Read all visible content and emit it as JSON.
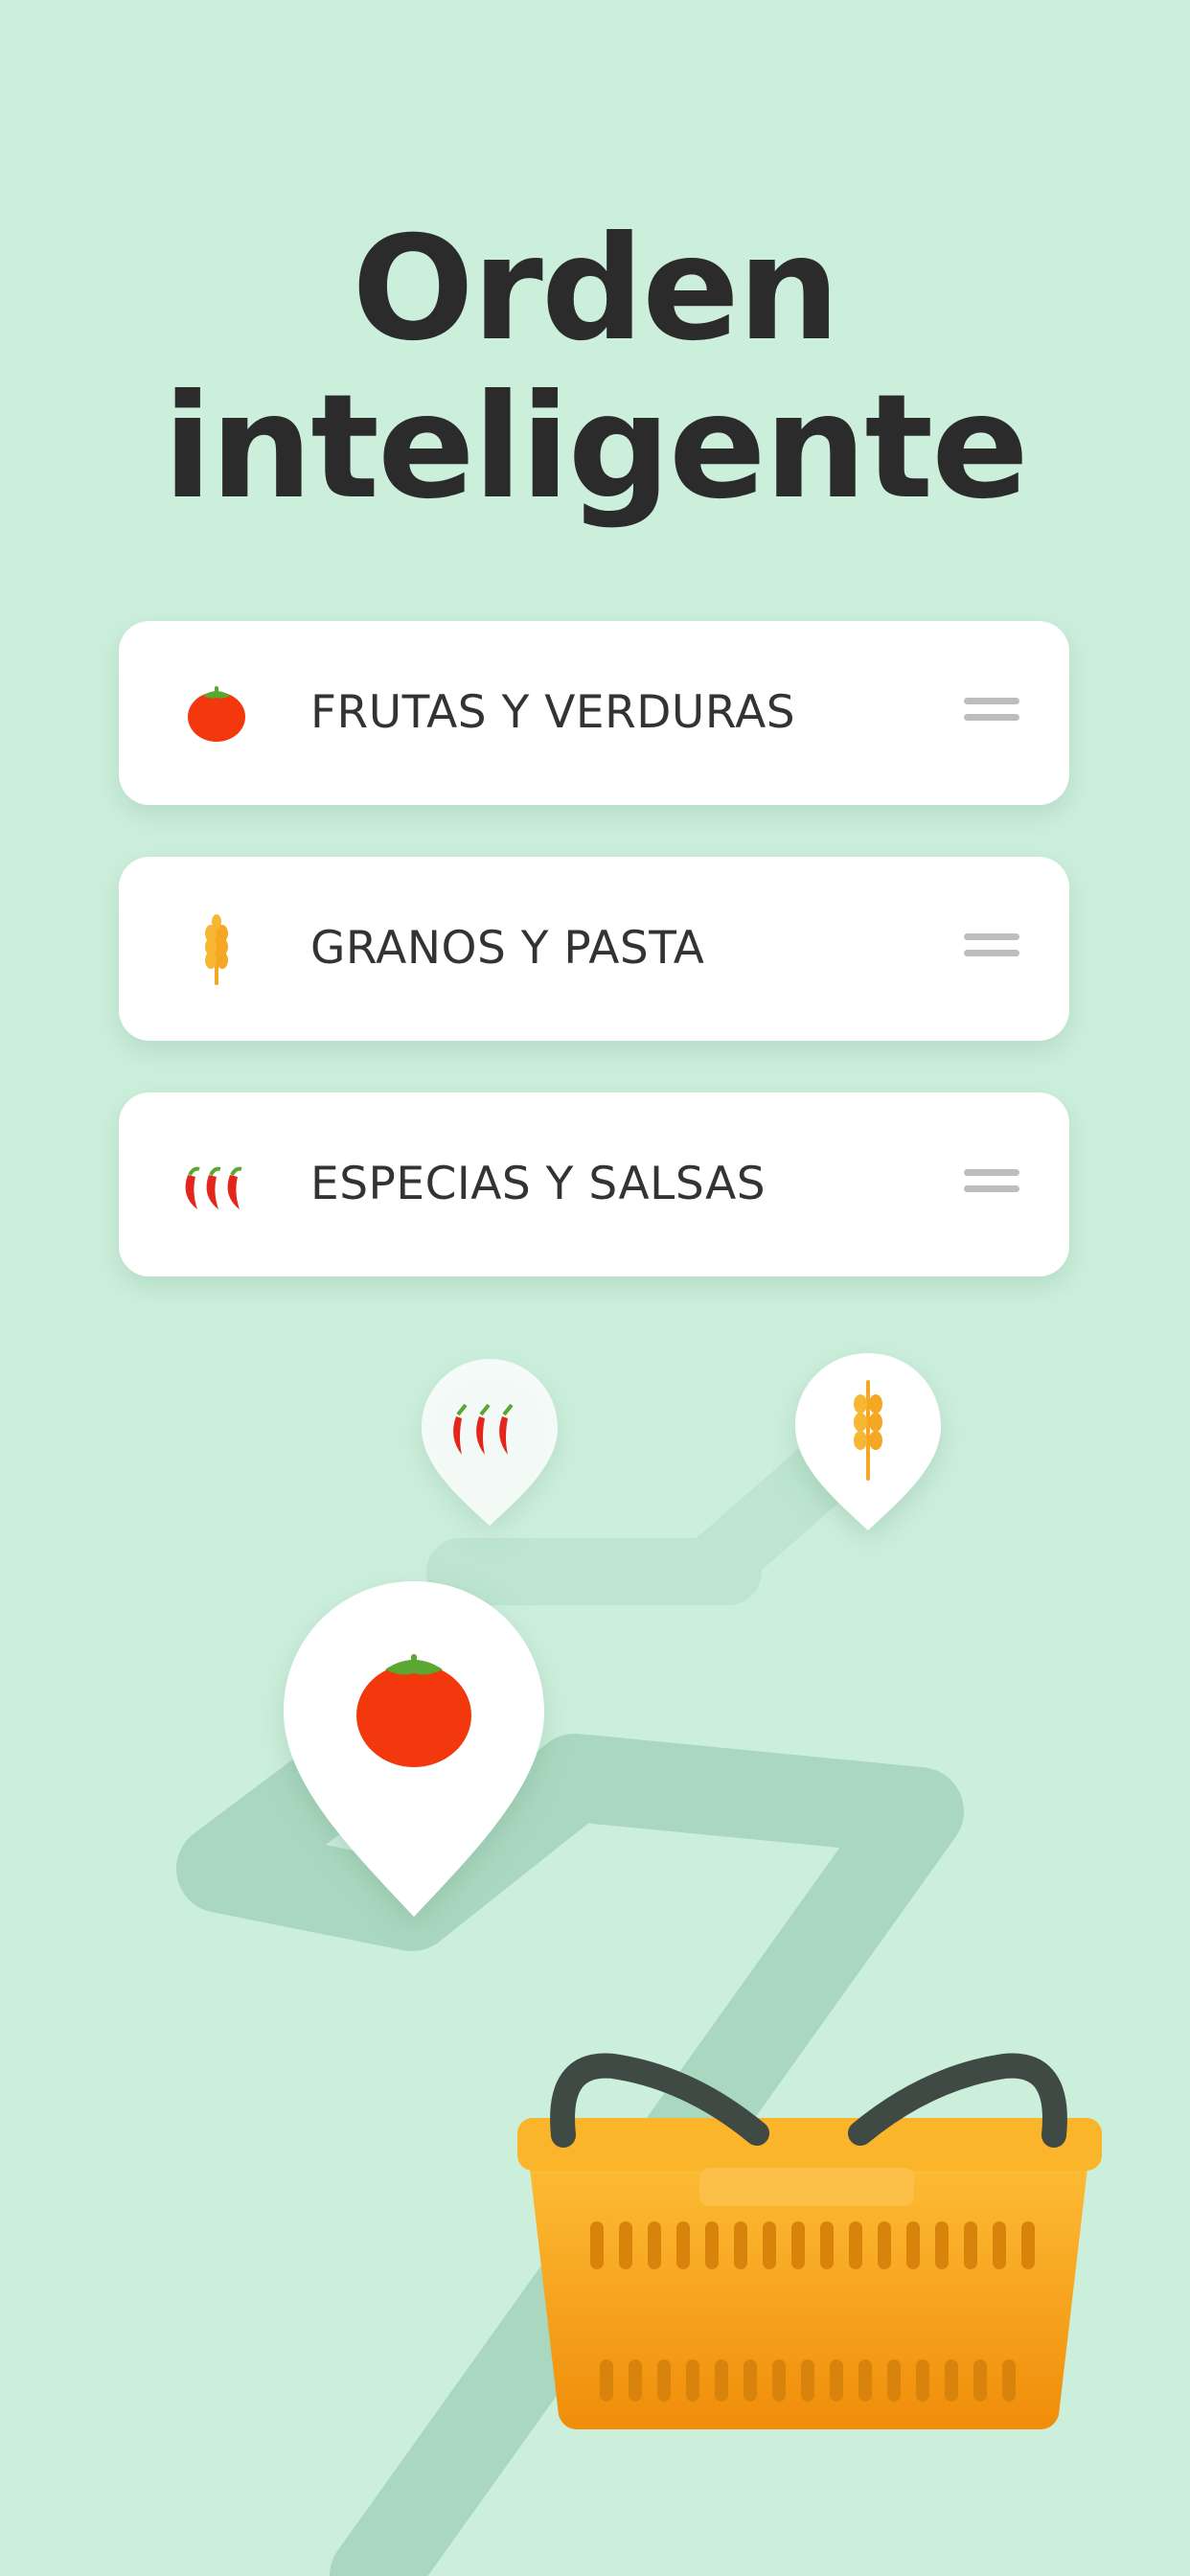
{
  "title": {
    "line1": "Orden",
    "line2": "inteligente"
  },
  "categories": [
    {
      "label": "FRUTAS Y VERDURAS",
      "icon": "tomato-icon"
    },
    {
      "label": "GRANOS Y PASTA",
      "icon": "wheat-icon"
    },
    {
      "label": "ESPECIAS Y SALSAS",
      "icon": "chili-peppers-icon"
    }
  ],
  "colors": {
    "background": "#ccefdc",
    "title_text": "#2b2b2b",
    "card": "#ffffff",
    "path": "#a9d6bf",
    "tomato": "#f4380e",
    "leaf": "#5aa832",
    "wheat": "#f5a623",
    "basket": "#f7a91c"
  }
}
